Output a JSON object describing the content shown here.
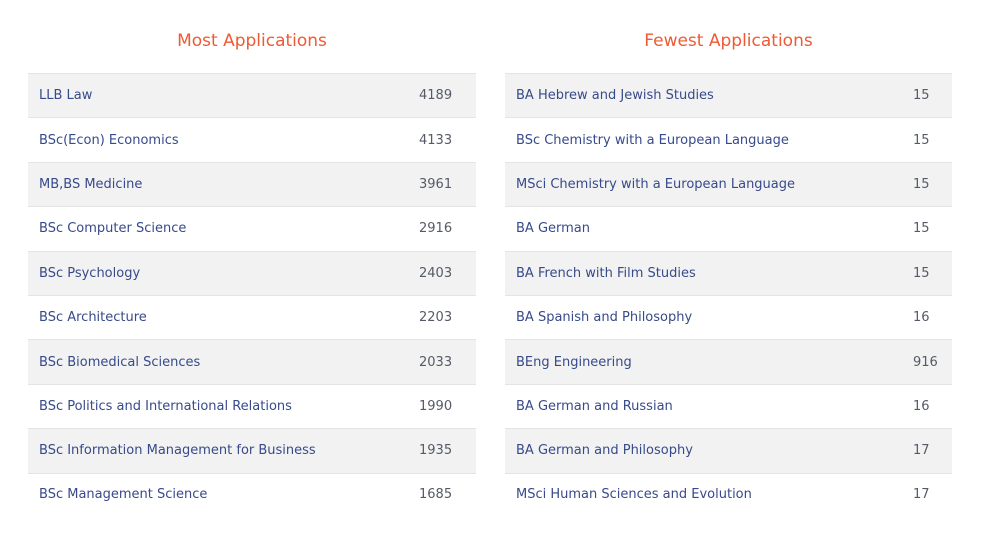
{
  "most": {
    "title": "Most Applications",
    "rows": [
      {
        "course": "LLB Law",
        "count": "4189"
      },
      {
        "course": "BSc(Econ) Economics",
        "count": "4133"
      },
      {
        "course": "MB,BS Medicine",
        "count": "3961"
      },
      {
        "course": "BSc Computer Science",
        "count": "2916"
      },
      {
        "course": "BSc Psychology",
        "count": "2403"
      },
      {
        "course": "BSc Architecture",
        "count": "2203"
      },
      {
        "course": "BSc Biomedical Sciences",
        "count": "2033"
      },
      {
        "course": "BSc Politics and International Relations",
        "count": "1990"
      },
      {
        "course": "BSc Information Management for Business",
        "count": "1935"
      },
      {
        "course": "BSc Management Science",
        "count": "1685"
      }
    ]
  },
  "fewest": {
    "title": "Fewest Applications",
    "rows": [
      {
        "course": "BA Hebrew and Jewish Studies",
        "count": "15"
      },
      {
        "course": "BSc Chemistry with a European Language",
        "count": "15"
      },
      {
        "course": "MSci Chemistry with a European Language",
        "count": "15"
      },
      {
        "course": "BA German",
        "count": "15"
      },
      {
        "course": "BA French with Film Studies",
        "count": "15"
      },
      {
        "course": "BA Spanish and Philosophy",
        "count": "16"
      },
      {
        "course": "BEng Engineering",
        "count": "916"
      },
      {
        "course": "BA German and Russian",
        "count": "16"
      },
      {
        "course": "BA German and Philosophy",
        "count": "17"
      },
      {
        "course": "MSci Human Sciences and Evolution",
        "count": "17"
      }
    ]
  }
}
